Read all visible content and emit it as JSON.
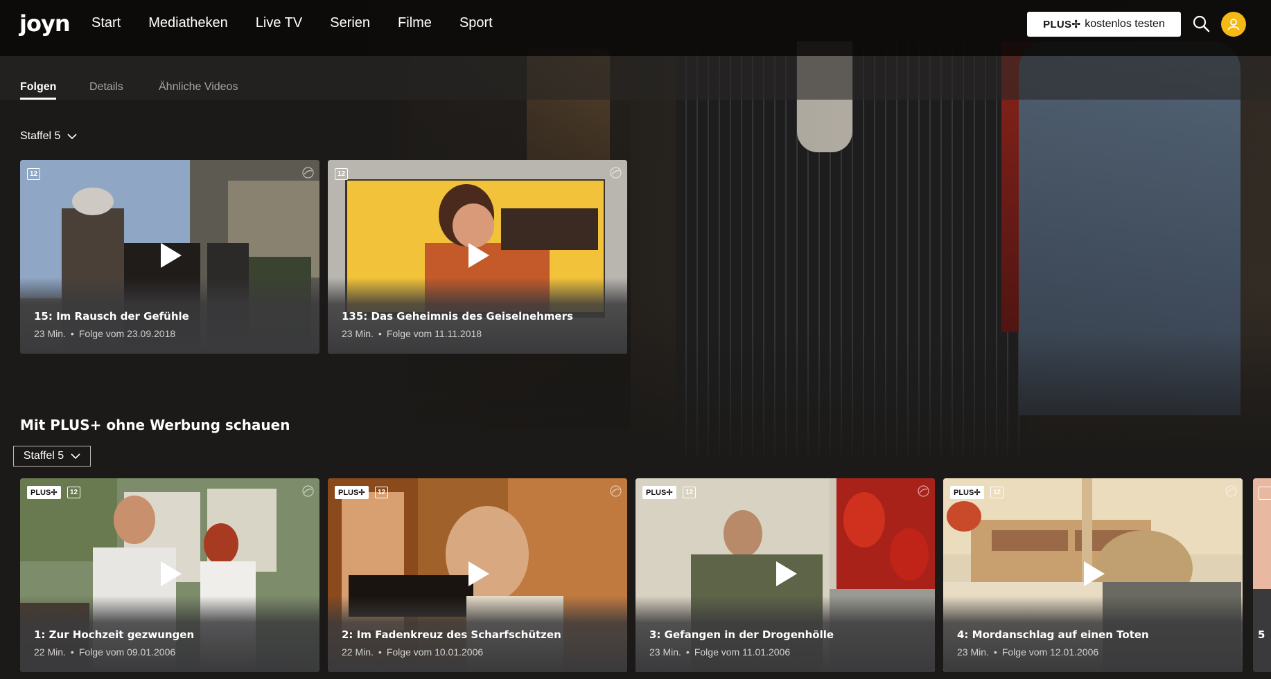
{
  "brand": {
    "logo": "joyn",
    "accent": "#f5b916"
  },
  "nav": {
    "items": [
      {
        "label": "Start"
      },
      {
        "label": "Mediatheken"
      },
      {
        "label": "Live TV"
      },
      {
        "label": "Serien"
      },
      {
        "label": "Filme"
      },
      {
        "label": "Sport"
      }
    ],
    "plus_button": {
      "logo": "PLUS✢",
      "label": "kostenlos testen"
    }
  },
  "tabs": [
    {
      "label": "Folgen",
      "active": true
    },
    {
      "label": "Details",
      "active": false
    },
    {
      "label": "Ähnliche Videos",
      "active": false
    }
  ],
  "episodes_section": {
    "season_label": "Staffel 5",
    "cards": [
      {
        "age": "12",
        "title": "15: Im Rausch der Gefühle",
        "duration": "23 Min.",
        "date": "Folge vom 23.09.2018"
      },
      {
        "age": "12",
        "title": "135: Das Geheimnis des Geiselnehmers",
        "duration": "23 Min.",
        "date": "Folge vom 11.11.2018"
      }
    ]
  },
  "plus_section": {
    "title": "Mit PLUS+ ohne Werbung schauen",
    "season_label": "Staffel 5",
    "cards": [
      {
        "plus": "PLUS✢",
        "age": "12",
        "title": "1: Zur Hochzeit gezwungen",
        "duration": "22 Min.",
        "date": "Folge vom 09.01.2006"
      },
      {
        "plus": "PLUS✢",
        "age": "12",
        "title": "2: Im Fadenkreuz des Scharfschützen",
        "duration": "22 Min.",
        "date": "Folge vom 10.01.2006"
      },
      {
        "plus": "PLUS✢",
        "age": "12",
        "title": "3: Gefangen in der Drogenhölle",
        "duration": "23 Min.",
        "date": "Folge vom 11.01.2006"
      },
      {
        "plus": "PLUS✢",
        "age": "12",
        "title": "4: Mordanschlag auf einen Toten",
        "duration": "23 Min.",
        "date": "Folge vom 12.01.2006"
      }
    ],
    "peek_label": "5"
  },
  "icons": {
    "search": "search-icon",
    "avatar": "user-icon",
    "play": "play-icon",
    "sender": "sender-logo-icon",
    "chevron": "chevron-down-icon"
  }
}
